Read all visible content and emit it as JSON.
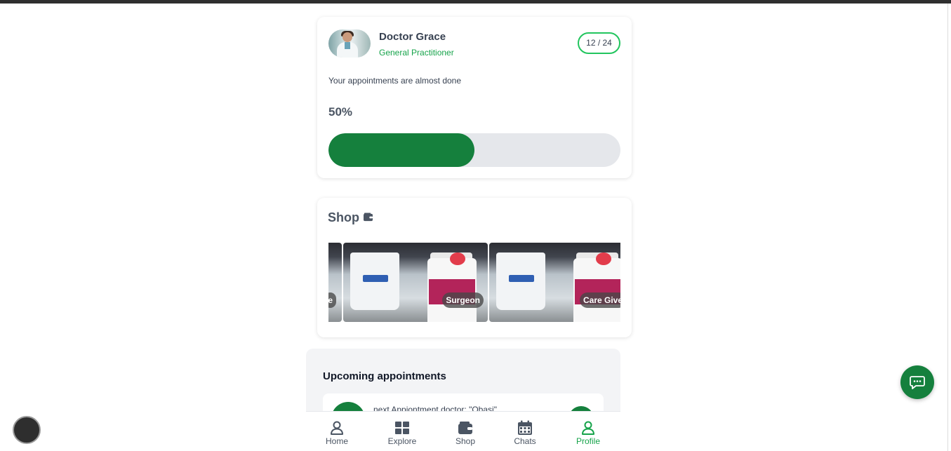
{
  "doctor": {
    "name": "Doctor Grace",
    "role": "General Practitioner",
    "counter": "12 / 24",
    "message": "Your appointments are almost done",
    "percent_label": "50%",
    "progress": 0.5
  },
  "shop": {
    "title": "Shop",
    "icon": "wallet-icon",
    "items": [
      {
        "label": "e"
      },
      {
        "label": "Surgeon"
      },
      {
        "label": "Care Give"
      }
    ]
  },
  "appointments": {
    "title": "Upcoming appointments",
    "next_text": "next Appiontment doctor: \"Obasi\""
  },
  "nav": {
    "items": [
      {
        "label": "Home",
        "icon": "user-icon"
      },
      {
        "label": "Explore",
        "icon": "grid-icon"
      },
      {
        "label": "Shop",
        "icon": "wallet-icon"
      },
      {
        "label": "Chats",
        "icon": "calendar-icon"
      },
      {
        "label": "Profile",
        "icon": "user-icon",
        "active": true
      }
    ]
  },
  "colors": {
    "brand": "#15803d",
    "accent_text": "#16a34a",
    "track": "#e5e7eb"
  }
}
